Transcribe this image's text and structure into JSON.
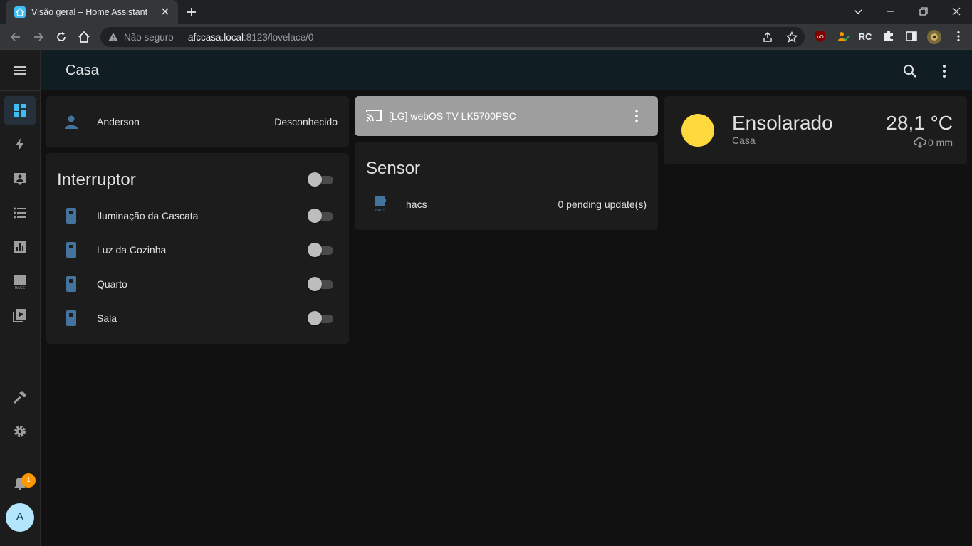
{
  "browser": {
    "tab_title": "Visão geral – Home Assistant",
    "not_secure_label": "Não seguro",
    "url_host": "afccasa.local",
    "url_rest": ":8123/lovelace/0"
  },
  "header": {
    "title": "Casa"
  },
  "sidebar": {
    "notification_count": "1",
    "user_initial": "A",
    "items": [
      {
        "icon": "dashboard-icon",
        "active": true
      },
      {
        "icon": "energy-icon"
      },
      {
        "icon": "map-icon"
      },
      {
        "icon": "logbook-icon"
      },
      {
        "icon": "history-icon"
      },
      {
        "icon": "hacs-icon"
      },
      {
        "icon": "media-icon"
      },
      {
        "icon": "developer-tools-icon"
      },
      {
        "icon": "settings-icon"
      }
    ]
  },
  "person_card": {
    "name": "Anderson",
    "state": "Desconhecido"
  },
  "switch_card": {
    "title": "Interruptor",
    "items": [
      {
        "label": "Iluminação da Cascata"
      },
      {
        "label": "Luz da Cozinha"
      },
      {
        "label": "Quarto"
      },
      {
        "label": "Sala"
      }
    ]
  },
  "media_card": {
    "title": "[LG] webOS TV LK5700PSC"
  },
  "sensor_card": {
    "title": "Sensor",
    "items": [
      {
        "label": "hacs",
        "value": "0 pending update(s)"
      }
    ]
  },
  "weather_card": {
    "condition": "Ensolarado",
    "location": "Casa",
    "temperature": "28,1 °C",
    "precipitation": "0 mm"
  },
  "colors": {
    "accent": "#41bdf5",
    "icon_blue": "#44739e",
    "sun": "#fdd93d",
    "badge": "#ff9800"
  }
}
